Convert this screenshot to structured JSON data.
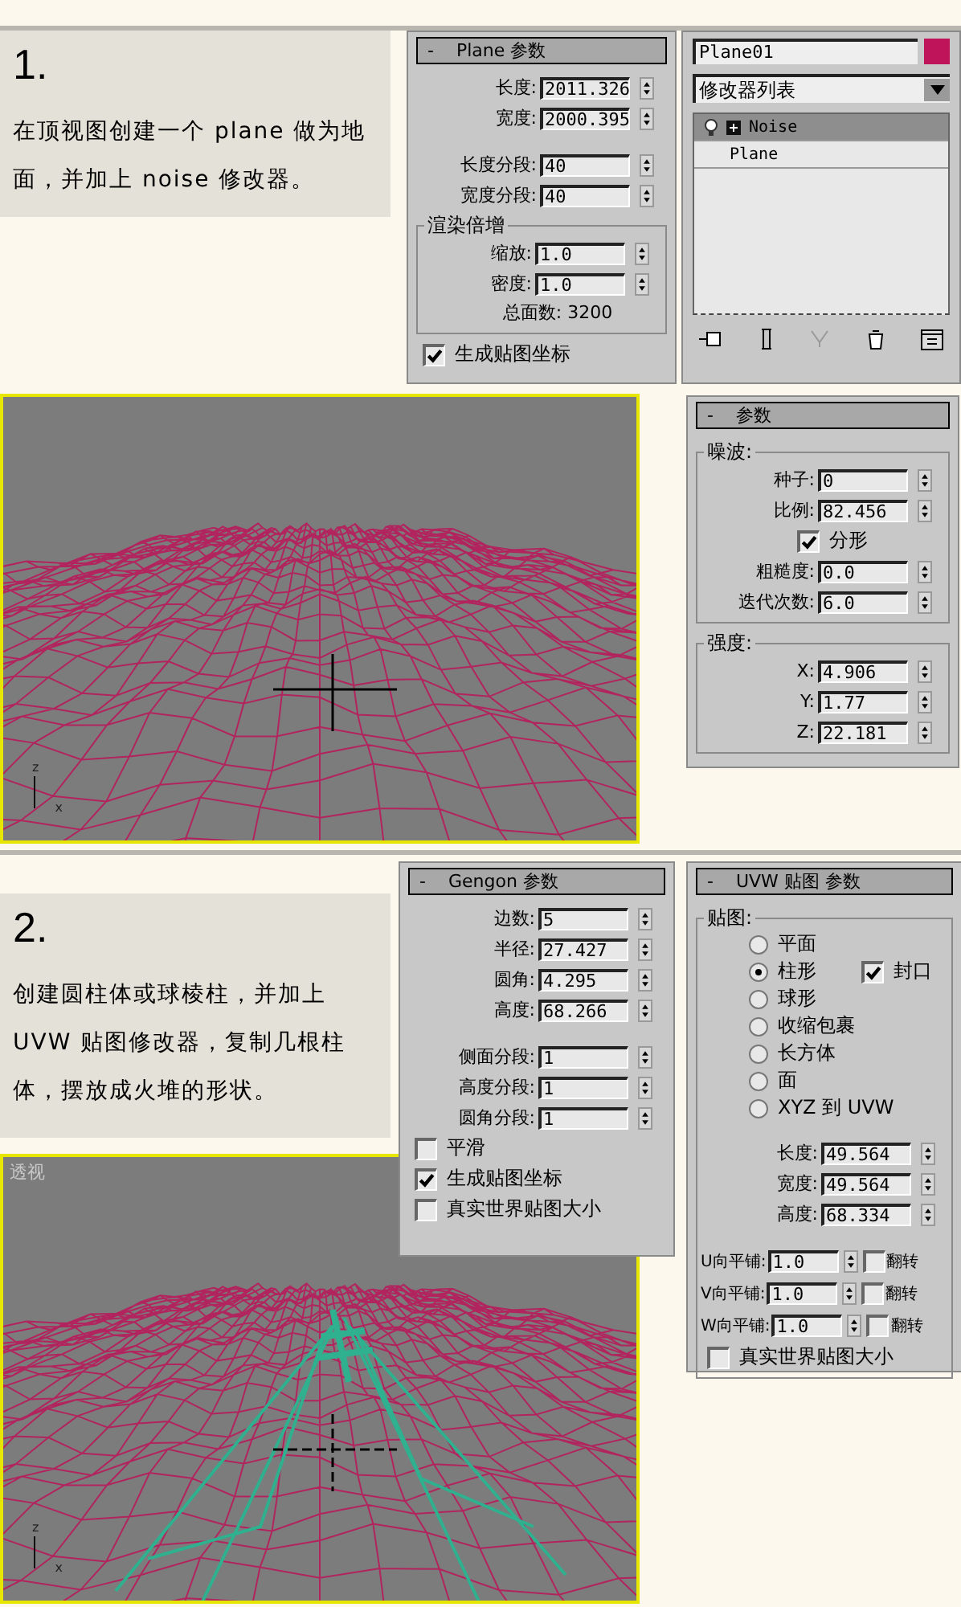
{
  "step1": {
    "number": "1.",
    "caption": "在顶视图创建一个 plane 做为地面，并加上 noise 修改器。",
    "plane_rollout": {
      "toggle": "-",
      "title": "Plane 参数",
      "items": [
        {
          "kind": "spinner",
          "label": "长度:",
          "value": "2011.326"
        },
        {
          "kind": "spinner",
          "label": "宽度:",
          "value": "2000.395"
        },
        {
          "kind": "spacer"
        },
        {
          "kind": "spinner",
          "label": "长度分段:",
          "value": "40"
        },
        {
          "kind": "spinner",
          "label": "宽度分段:",
          "value": "40"
        },
        {
          "kind": "group",
          "title": "渲染倍增",
          "items": [
            {
              "kind": "spinner",
              "label": "缩放:",
              "value": "1.0"
            },
            {
              "kind": "spinner",
              "label": "密度:",
              "value": "1.0"
            },
            {
              "kind": "note",
              "text": "总面数: 3200"
            }
          ]
        },
        {
          "kind": "checkbox",
          "label": "生成贴图坐标",
          "checked": true
        }
      ]
    },
    "modifier_panel": {
      "name": "Plane01",
      "color": "#c0145a",
      "list_label": "修改器列表",
      "stack": [
        {
          "label": "Noise",
          "selected": true,
          "expandable": true
        },
        {
          "label": "Plane",
          "selected": false,
          "expandable": false
        }
      ]
    },
    "viewport": {
      "kind": "picture",
      "columns": false,
      "axis": {
        "up": "z",
        "right": "x"
      }
    },
    "noise_rollout": {
      "toggle": "-",
      "title": "参数",
      "items": [
        {
          "kind": "group",
          "title": "噪波:",
          "items": [
            {
              "kind": "spinner",
              "label": "种子:",
              "value": "0"
            },
            {
              "kind": "spinner",
              "label": "比例:",
              "value": "82.456"
            },
            {
              "kind": "checkbox",
              "label": "分形",
              "checked": true
            },
            {
              "kind": "spinner",
              "label": "粗糙度:",
              "value": "0.0"
            },
            {
              "kind": "spinner",
              "label": "迭代次数:",
              "value": "6.0"
            }
          ]
        },
        {
          "kind": "group",
          "title": "强度:",
          "items": [
            {
              "kind": "spinner",
              "label": "X:",
              "value": "4.906"
            },
            {
              "kind": "spinner",
              "label": "Y:",
              "value": "1.77"
            },
            {
              "kind": "spinner",
              "label": "Z:",
              "value": "22.181"
            }
          ]
        }
      ]
    }
  },
  "step2": {
    "number": "2.",
    "caption": "创建圆柱体或球棱柱，并加上UVW 贴图修改器，复制几根柱体，摆放成火堆的形状。",
    "gengon_rollout": {
      "toggle": "-",
      "title": "Gengon 参数",
      "items": [
        {
          "kind": "spinner",
          "label": "边数:",
          "value": "5"
        },
        {
          "kind": "spinner",
          "label": "半径:",
          "value": "27.427"
        },
        {
          "kind": "spinner",
          "label": "圆角:",
          "value": "4.295"
        },
        {
          "kind": "spinner",
          "label": "高度:",
          "value": "68.266"
        },
        {
          "kind": "spacer"
        },
        {
          "kind": "spinner",
          "label": "侧面分段:",
          "value": "1"
        },
        {
          "kind": "spinner",
          "label": "高度分段:",
          "value": "1"
        },
        {
          "kind": "spinner",
          "label": "圆角分段:",
          "value": "1"
        },
        {
          "kind": "checkbox",
          "label": "平滑",
          "checked": false
        },
        {
          "kind": "checkbox",
          "label": "生成贴图坐标",
          "checked": true
        },
        {
          "kind": "checkbox",
          "label": "真实世界贴图大小",
          "checked": false
        }
      ]
    },
    "viewport": {
      "kind": "picture",
      "columns": true,
      "label": "透视",
      "axis": {
        "up": "z",
        "right": "x"
      }
    },
    "uvw_rollout": {
      "toggle": "-",
      "title": "UVW 贴图 参数",
      "items": [
        {
          "kind": "group",
          "title": "贴图:",
          "items": [
            {
              "kind": "radio",
              "label": "平面",
              "selected": false
            },
            {
              "kind": "radio",
              "label": "柱形",
              "selected": true,
              "option": {
                "label": "封口",
                "checked": true
              }
            },
            {
              "kind": "radio",
              "label": "球形",
              "selected": false
            },
            {
              "kind": "radio",
              "label": "收缩包裹",
              "selected": false
            },
            {
              "kind": "radio",
              "label": "长方体",
              "selected": false
            },
            {
              "kind": "radio",
              "label": "面",
              "selected": false
            },
            {
              "kind": "radio",
              "label": "XYZ 到 UVW",
              "selected": false
            },
            {
              "kind": "spacer"
            },
            {
              "kind": "spinner",
              "label": "长度:",
              "value": "49.564"
            },
            {
              "kind": "spinner",
              "label": "宽度:",
              "value": "49.564"
            },
            {
              "kind": "spinner",
              "label": "高度:",
              "value": "68.334"
            },
            {
              "kind": "spacer"
            },
            {
              "kind": "tile",
              "label": "U向平铺:",
              "value": "1.0",
              "flip_label": "翻转",
              "flip_checked": false
            },
            {
              "kind": "tile",
              "label": "V向平铺:",
              "value": "1.0",
              "flip_label": "翻转",
              "flip_checked": false
            },
            {
              "kind": "tile",
              "label": "W向平铺:",
              "value": "1.0",
              "flip_label": "翻转",
              "flip_checked": false
            },
            {
              "kind": "checkbox",
              "label": "真实世界贴图大小",
              "checked": false
            }
          ]
        }
      ]
    }
  }
}
